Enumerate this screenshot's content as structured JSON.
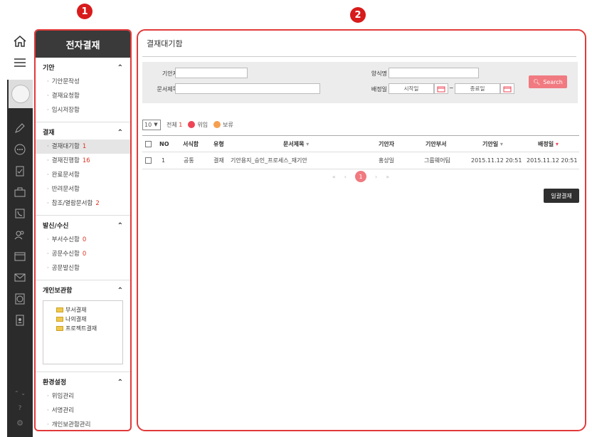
{
  "markers": {
    "one": "1",
    "two": "2"
  },
  "nav": {
    "title": "전자결재",
    "sections": [
      {
        "title": "기안",
        "items": [
          {
            "label": "기안문작성"
          },
          {
            "label": "결재요청함"
          },
          {
            "label": "임시저장함"
          }
        ]
      },
      {
        "title": "결재",
        "items": [
          {
            "label": "결재대기함",
            "count": "1"
          },
          {
            "label": "결재진행함",
            "count": "16"
          },
          {
            "label": "완료문서함"
          },
          {
            "label": "반려문서함"
          },
          {
            "label": "참조/열람문서함",
            "count": "2"
          }
        ]
      },
      {
        "title": "발신/수신",
        "items": [
          {
            "label": "부서수신함",
            "count": "0"
          },
          {
            "label": "공문수신함",
            "count": "0"
          },
          {
            "label": "공문발신함"
          }
        ]
      },
      {
        "title": "개인보관함",
        "tree": [
          "부서결재",
          "나의결재",
          "프로젝트결재"
        ]
      },
      {
        "title": "환경설정",
        "items": [
          {
            "label": "위임관리"
          },
          {
            "label": "서명관리"
          },
          {
            "label": "개인보관함관리"
          }
        ]
      }
    ]
  },
  "main": {
    "title": "결재대기함",
    "filter": {
      "drafter_label": "기안자",
      "doc_title_label": "문서제목",
      "form_label": "양식명",
      "approve_date_label": "배정일",
      "start_placeholder": "시작일",
      "end_placeholder": "종료일",
      "range_sep": "~",
      "search_label": "Search"
    },
    "toolbar": {
      "page_size": "10",
      "total_label": "전체",
      "total_count": "1",
      "delegate_label": "위임",
      "hold_label": "보류"
    },
    "columns": [
      "NO",
      "서식함",
      "유형",
      "문서제목",
      "기안자",
      "기안부서",
      "기안일",
      "배정일"
    ],
    "rows": [
      {
        "no": "1",
        "box": "공통",
        "type": "결재",
        "title": "기안용지_승인_프로세스_재기안",
        "drafter": "홍상일",
        "dept": "그룹웨어팀",
        "draft_date": "2015.11.12 20:51",
        "assign_date": "2015.11.12 20:51"
      }
    ],
    "pager": {
      "first": "«",
      "prev": "‹",
      "current": "1",
      "next": "›",
      "last": "»"
    },
    "bulk_label": "일괄결재"
  },
  "colors": {
    "accent": "#e23a3a",
    "pink": "#f07a80",
    "dark": "#2b2b2b"
  }
}
